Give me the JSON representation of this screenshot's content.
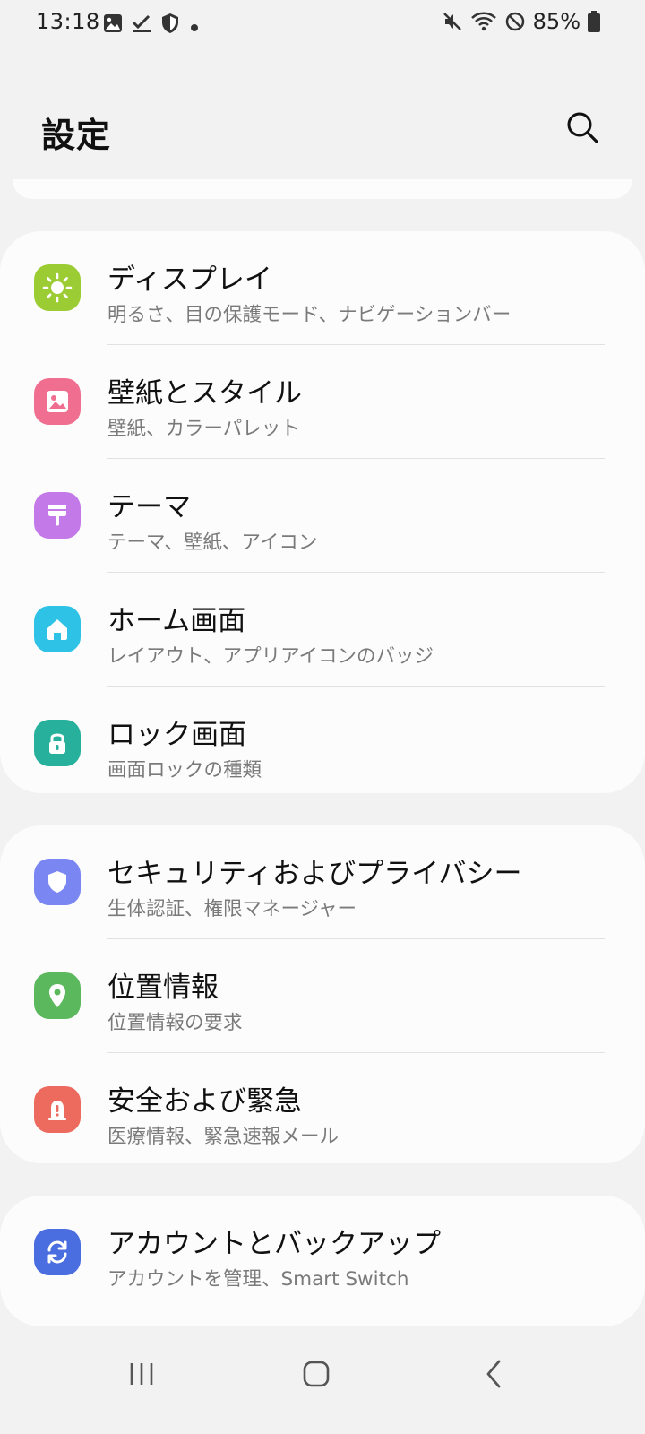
{
  "status": {
    "time": "13:18",
    "battery": "85%",
    "left_icons": [
      "gallery-icon",
      "task-done-icon",
      "shield-icon",
      "dot-icon"
    ],
    "right_icons": [
      "mute-icon",
      "wifi-icon",
      "no-disturb-icon",
      "battery-icon"
    ]
  },
  "header": {
    "title": "設定",
    "search_icon": "search-icon"
  },
  "groups": [
    {
      "items": [
        {
          "title": "ディスプレイ",
          "subtitle": "明るさ、目の保護モード、ナビゲーションバー",
          "icon": "sun-icon",
          "color": "#9ccc33"
        },
        {
          "title": "壁紙とスタイル",
          "subtitle": "壁紙、カラーパレット",
          "icon": "image-icon",
          "color": "#f06e8f"
        },
        {
          "title": "テーマ",
          "subtitle": "テーマ、壁紙、アイコン",
          "icon": "brush-icon",
          "color": "#c37ae8"
        },
        {
          "title": "ホーム画面",
          "subtitle": "レイアウト、アプリアイコンのバッジ",
          "icon": "home-icon",
          "color": "#2ec3e6"
        },
        {
          "title": "ロック画面",
          "subtitle": "画面ロックの種類",
          "icon": "lock-icon",
          "color": "#27b09b"
        }
      ]
    },
    {
      "items": [
        {
          "title": "セキュリティおよびプライバシー",
          "subtitle": "生体認証、権限マネージャー",
          "icon": "shield-icon",
          "color": "#7a86f2"
        },
        {
          "title": "位置情報",
          "subtitle": "位置情報の要求",
          "icon": "location-pin-icon",
          "color": "#5cb85c"
        },
        {
          "title": "安全および緊急",
          "subtitle": "医療情報、緊急速報メール",
          "icon": "siren-icon",
          "color": "#ec6a5e"
        }
      ]
    },
    {
      "items": [
        {
          "title": "アカウントとバックアップ",
          "subtitle": "アカウントを管理、Smart Switch",
          "icon": "sync-icon",
          "color": "#4a6de0"
        }
      ]
    }
  ],
  "navbar": {
    "buttons": [
      "recents-icon",
      "home-button-icon",
      "back-icon"
    ]
  }
}
